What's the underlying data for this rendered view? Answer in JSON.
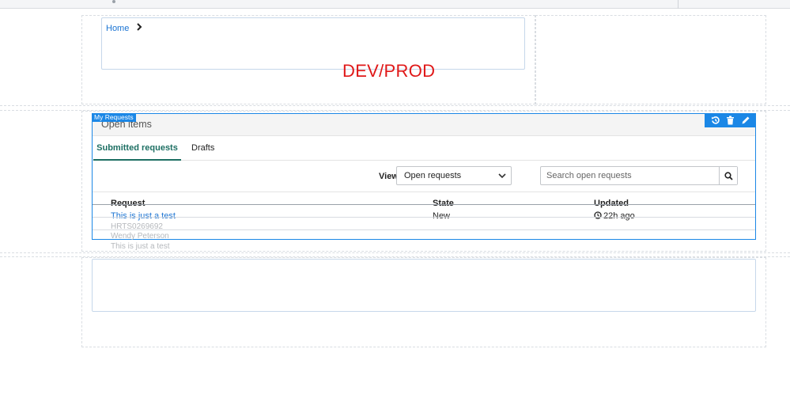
{
  "breadcrumb": {
    "home_label": "Home"
  },
  "environment_label": "DEV/PROD",
  "widget": {
    "tag_label": "My Requests",
    "title": "Open items",
    "tabs": [
      {
        "label": "Submitted requests",
        "active": true
      },
      {
        "label": "Drafts",
        "active": false
      }
    ],
    "view": {
      "label": "View",
      "selected": "Open requests"
    },
    "search": {
      "placeholder": "Search open requests"
    },
    "columns": [
      "Request",
      "State",
      "Updated"
    ],
    "rows": [
      {
        "request": "This is just a test",
        "number": "HRTS0269692",
        "requester": "Wendy Peterson",
        "description": "This is just a test",
        "state": "New",
        "updated": "22h ago"
      }
    ],
    "tool_icons": [
      "history-icon",
      "trash-icon",
      "pencil-icon"
    ]
  },
  "colors": {
    "accent": "#1b87e6",
    "link": "#1b74d3",
    "env": "#e01818",
    "tab_active": "#1d6f63"
  }
}
